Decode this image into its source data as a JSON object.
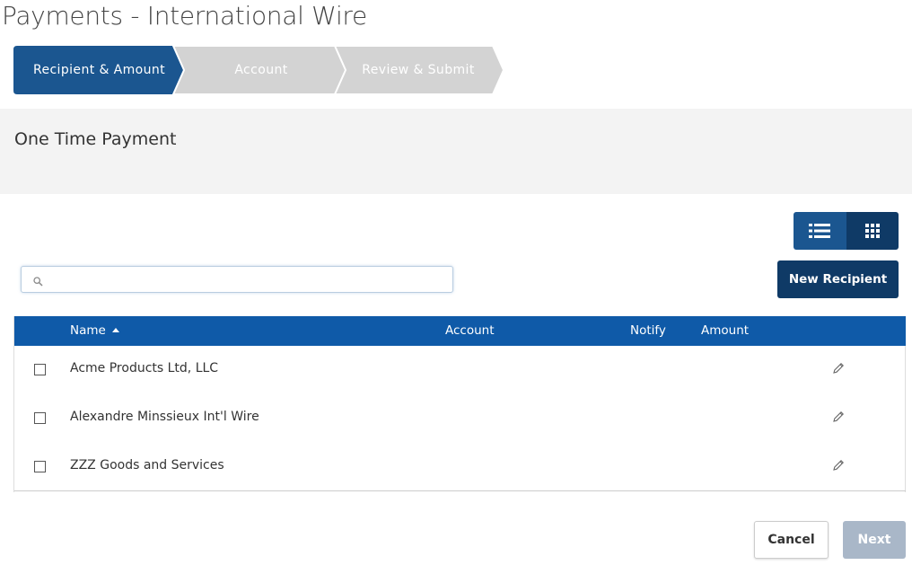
{
  "page": {
    "title": "Payments - International Wire"
  },
  "wizard": {
    "steps": [
      {
        "label": "Recipient & Amount",
        "state": "active"
      },
      {
        "label": "Account",
        "state": "inactive"
      },
      {
        "label": "Review & Submit",
        "state": "inactive"
      }
    ],
    "colors": {
      "active": "#1b5690",
      "inactive": "#d3d3d3"
    }
  },
  "section": {
    "title": "One Time Payment"
  },
  "view_toggle": {
    "options": [
      "list-view-icon",
      "grid-view-icon"
    ],
    "selected": "list-view-icon"
  },
  "search": {
    "placeholder": "",
    "value": "",
    "icon": "search-icon"
  },
  "toolbar": {
    "new_recipient_label": "New Recipient"
  },
  "table": {
    "columns": [
      {
        "label": "Name",
        "sort": "ascending"
      },
      {
        "label": "Account"
      },
      {
        "label": "Notify"
      },
      {
        "label": "Amount"
      }
    ],
    "rows": [
      {
        "name": "Acme Products Ltd, LLC",
        "account": "",
        "notify": "",
        "amount": "",
        "checked": false
      },
      {
        "name": "Alexandre Minssieux Int'l Wire",
        "account": "",
        "notify": "",
        "amount": "",
        "checked": false
      },
      {
        "name": "ZZZ Goods and Services",
        "account": "",
        "notify": "",
        "amount": "",
        "checked": false
      }
    ],
    "header_color": "#0f5aa8"
  },
  "footer": {
    "cancel_label": "Cancel",
    "next_label": "Next",
    "next_enabled": false
  }
}
